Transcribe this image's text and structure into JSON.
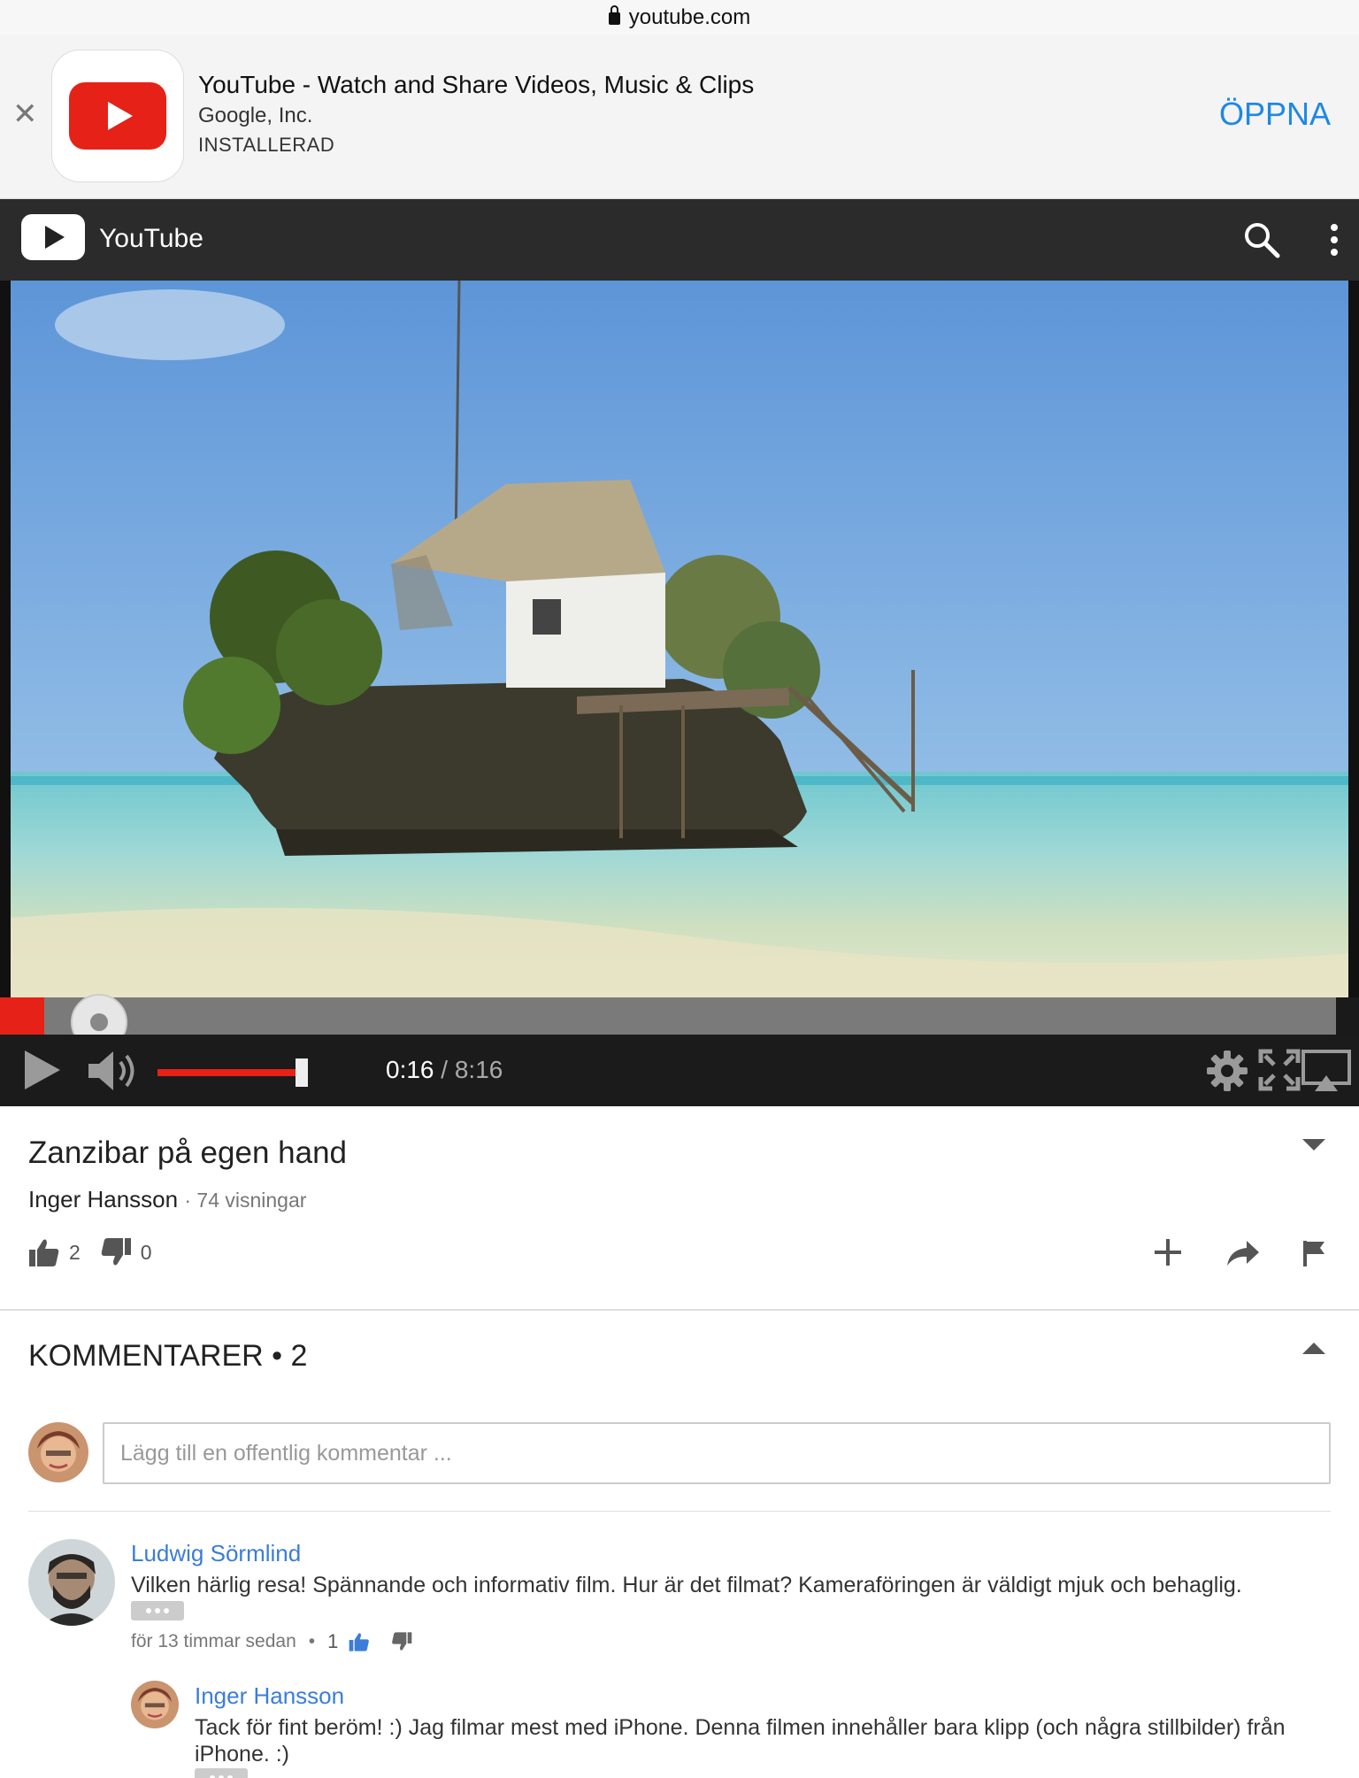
{
  "url_bar": {
    "domain": "youtube.com"
  },
  "app_banner": {
    "title": "YouTube - Watch and Share Videos, Music & Clips",
    "publisher": "Google, Inc.",
    "status": "INSTALLERAD",
    "open_label": "ÖPPNA",
    "close_icon": "close-icon"
  },
  "header": {
    "title": "YouTube",
    "icons": [
      "search-icon",
      "more-vert-icon"
    ]
  },
  "player": {
    "current_time": "0:16",
    "total_time": "/ 8:16",
    "progress_fraction": 0.033,
    "volume_fraction": 0.98,
    "icons": [
      "play-icon",
      "volume-icon",
      "settings-gear-icon",
      "fullscreen-icon",
      "airplay-icon"
    ],
    "accent_color": "#e62117"
  },
  "video": {
    "title": "Zanzibar på egen hand",
    "channel": "Inger Hansson",
    "views": "74 visningar",
    "likes": "2",
    "dislikes": "0",
    "actions": [
      "add-to-playlist-icon",
      "share-icon",
      "flag-icon"
    ]
  },
  "comments": {
    "header": "KOMMENTARER • 2",
    "input_placeholder": "Lägg till en offentlig kommentar ...",
    "items": [
      {
        "author": "Ludwig Sörmlind",
        "text": "Vilken härlig resa! Spännande och informativ film. Hur är det filmat? Kameraföringen är väldigt mjuk och behaglig.",
        "time": "för 13 timmar sedan",
        "likes": "1"
      },
      {
        "author": "Inger Hansson",
        "text": "Tack för fint beröm! :) Jag filmar mest med iPhone. Denna filmen innehåller bara klipp (och några stillbilder) från iPhone. :)"
      }
    ]
  }
}
